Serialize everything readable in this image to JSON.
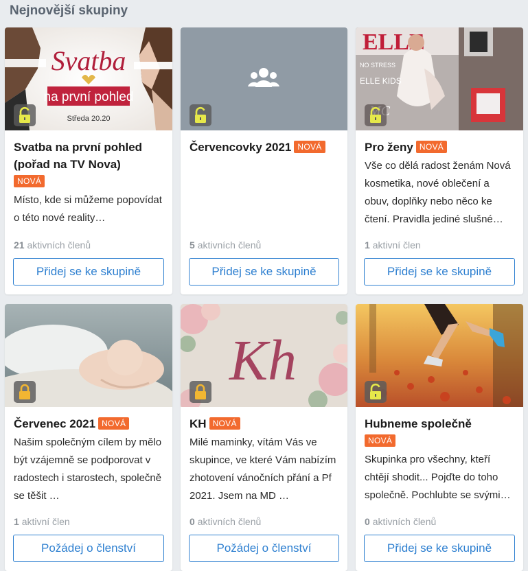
{
  "heading": "Nejnovější skupiny",
  "badge_new": "NOVÁ",
  "cards": [
    {
      "title": "Svatba na první pohled (pořad na TV Nova)",
      "badge": "NOVÁ",
      "description": "Místo, kde si můžeme popovídat o této nové reality…",
      "members_count": "21",
      "members_label": "aktivních členů",
      "button": "Přidej se ke skupině",
      "lock": "unlocked",
      "thumb_text": {
        "line1": "Svatba",
        "line2": "na první pohled",
        "line3": "Středa 20.20"
      }
    },
    {
      "title": "Červencovky 2021",
      "badge": "NOVÁ",
      "description": "",
      "members_count": "5",
      "members_label": "aktivních členů",
      "button": "Přidej se ke skupině",
      "lock": "unlocked"
    },
    {
      "title": "Pro ženy",
      "badge": "NOVÁ",
      "description": "Vše co dělá radost ženám Nová kosmetika, nové oblečení a obuv, doplňky nebo něco ke čtení. Pravidla jediné slušné…",
      "members_count": "1",
      "members_label": "aktivní člen",
      "button": "Přidej se ke skupině",
      "lock": "unlocked"
    },
    {
      "title": "Červenec 2021",
      "badge": "NOVÁ",
      "description": "Našim společným cílem by mělo být vzájemně se podporovat v radostech i starostech, společně se těšit …",
      "members_count": "1",
      "members_label": "aktivní člen",
      "button": "Požádej o členství",
      "lock": "locked"
    },
    {
      "title": "KH",
      "badge": "NOVÁ",
      "description": "Milé maminky, vítám Vás ve skupince, ve které Vám nabízím zhotovení vánočních přání a Pf 2021. Jsem na MD …",
      "members_count": "0",
      "members_label": "aktivních členů",
      "button": "Požádej o členství",
      "lock": "locked",
      "thumb_text": {
        "logo": "Kh"
      }
    },
    {
      "title": "Hubneme společně",
      "badge": "NOVÁ",
      "description": "Skupinka pro všechny, kteří chtějí shodit... Pojďte do toho společně. Pochlubte se svými…",
      "members_count": "0",
      "members_label": "aktivních členů",
      "button": "Přidej se ke skupině",
      "lock": "unlocked"
    }
  ],
  "colors": {
    "badge": "#f26a2e",
    "button": "#2d7fd0",
    "unlock_icon": "#e6e84a",
    "lock_icon": "#f2b632",
    "group_placeholder": "#909ba5"
  }
}
